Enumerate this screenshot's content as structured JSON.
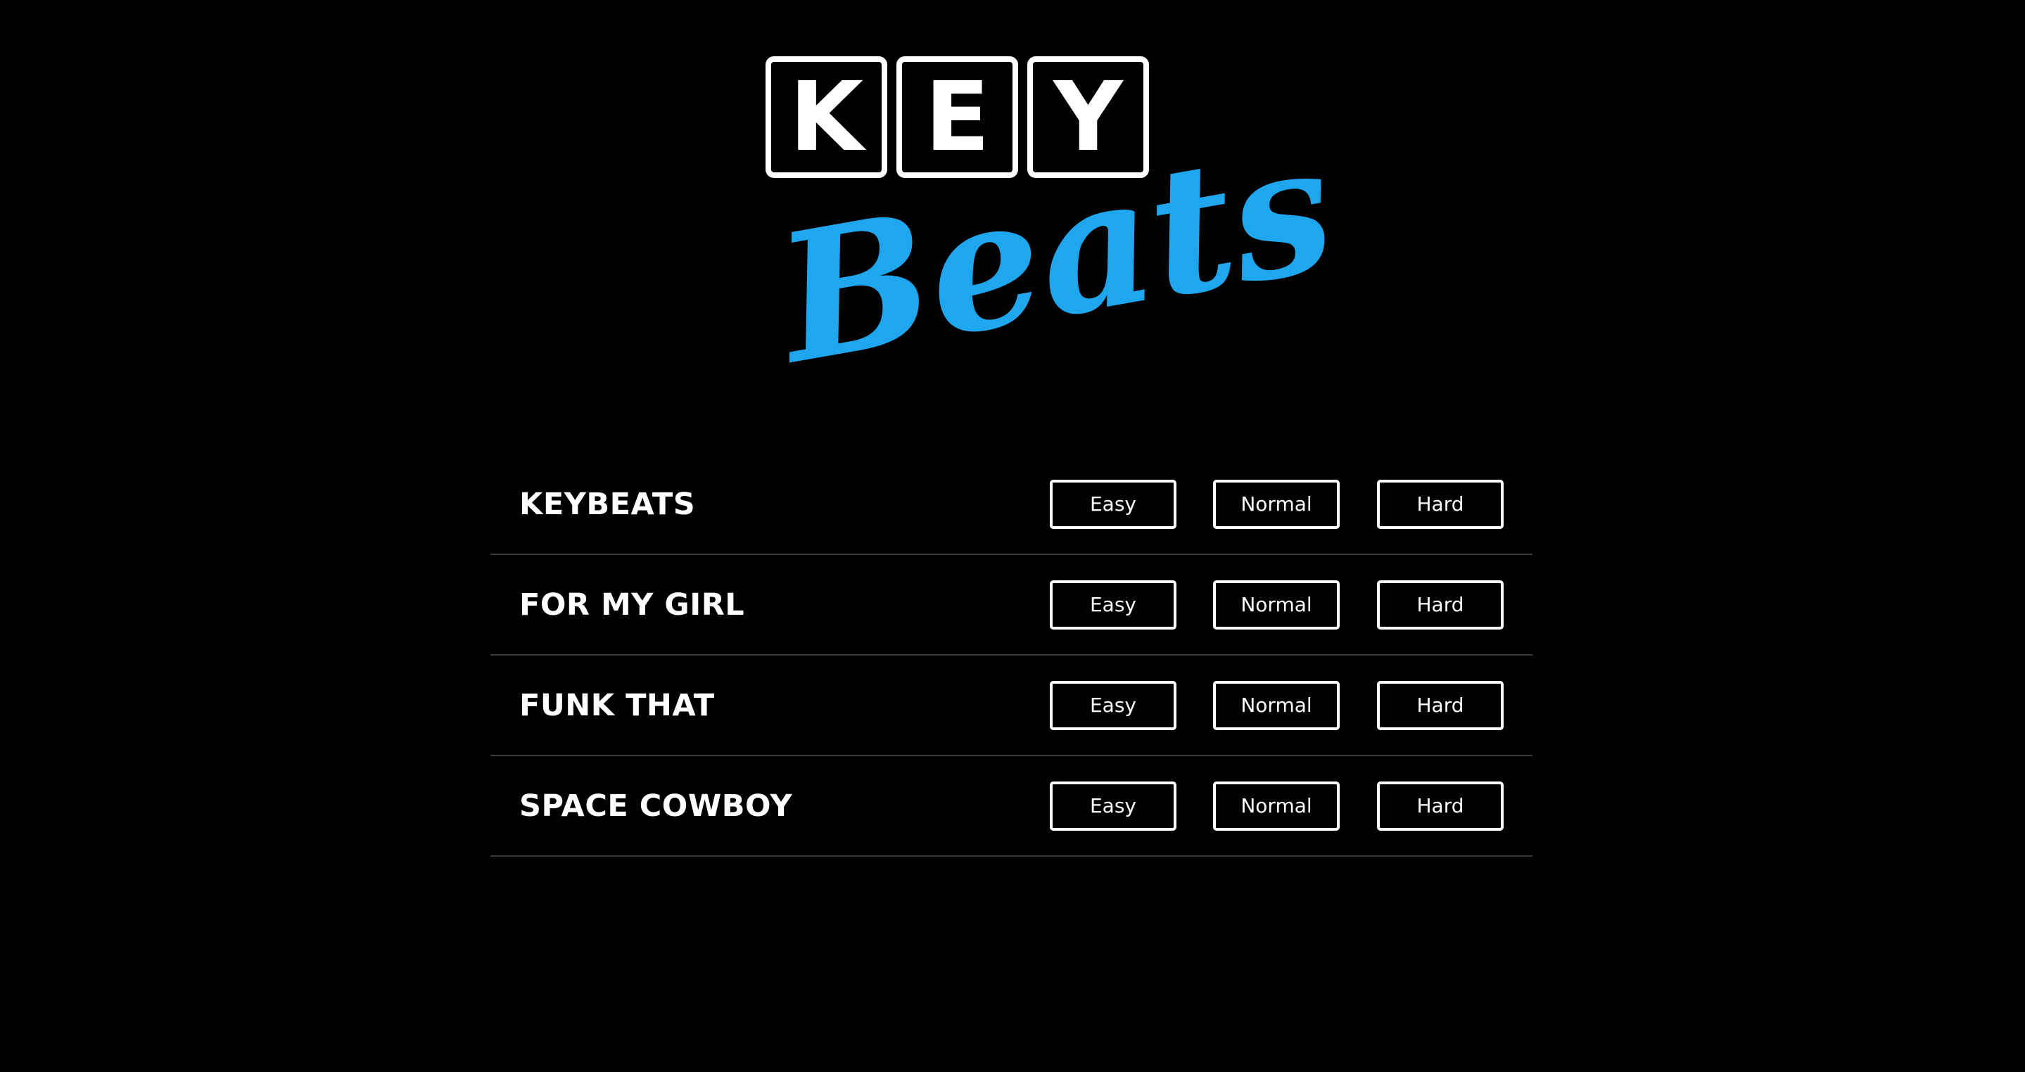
{
  "logo": {
    "key_letters": [
      "K",
      "E",
      "Y"
    ],
    "beats_text": "Beats",
    "accent_color": "#1ea7ef"
  },
  "songs": [
    {
      "title": "KEYBEATS",
      "difficulties": [
        "Easy",
        "Normal",
        "Hard"
      ]
    },
    {
      "title": "FOR MY GIRL",
      "difficulties": [
        "Easy",
        "Normal",
        "Hard"
      ]
    },
    {
      "title": "FUNK THAT",
      "difficulties": [
        "Easy",
        "Normal",
        "Hard"
      ]
    },
    {
      "title": "SPACE COWBOY",
      "difficulties": [
        "Easy",
        "Normal",
        "Hard"
      ]
    }
  ],
  "colors": {
    "background": "#000000",
    "text": "#ffffff",
    "divider": "#3a3a3a"
  }
}
